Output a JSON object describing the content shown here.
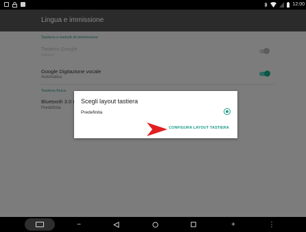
{
  "status_bar": {
    "time": "12:00",
    "left_icons": [
      "image-icon",
      "lock-icon",
      "notification-icon"
    ],
    "right_icons": [
      "bluetooth-icon",
      "wifi-icon",
      "signal-icon",
      "battery-icon"
    ]
  },
  "app": {
    "title": "Lingua e immissione",
    "sections": [
      {
        "header": "Tastiera e metodi di immissione"
      },
      {
        "header": "Tastiera fisica"
      }
    ],
    "prefs": [
      {
        "title": "Tastiera Google",
        "subtitle": "Italiano",
        "enabled": false,
        "switch_on": false
      },
      {
        "title": "Google Digitazione vocale",
        "subtitle": "Automatica",
        "enabled": true,
        "switch_on": true
      },
      {
        "title": "Bluetooth 3.0 K",
        "subtitle": "Predefinita"
      }
    ]
  },
  "dialog": {
    "title": "Scegli layout tastiera",
    "option_label": "Predefinita",
    "option_selected": true,
    "action_label": "CONFIGURA LAYOUT TASTIERA"
  },
  "colors": {
    "accent": "#1a9c88",
    "arrow": "#e02020"
  },
  "nav_bar": {
    "items": [
      "screenshot-icon",
      "volume-down-icon",
      "back-icon",
      "home-icon",
      "recents-icon",
      "volume-up-icon",
      "menu-icon"
    ],
    "volume_down_glyph": "−",
    "volume_up_glyph": "+",
    "menu_glyph": "⋮"
  }
}
